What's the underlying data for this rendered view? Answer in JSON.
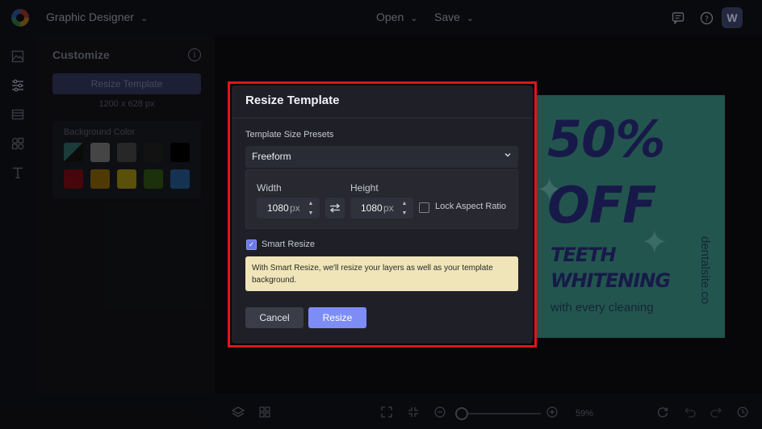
{
  "topbar": {
    "app_mode": "Graphic Designer",
    "open_label": "Open",
    "save_label": "Save",
    "avatar_initial": "W",
    "icons": [
      "comment-icon",
      "help-icon"
    ]
  },
  "rail": {
    "icons": [
      "image-icon",
      "sliders-icon",
      "layout-icon",
      "elements-icon",
      "text-icon"
    ]
  },
  "customize": {
    "title": "Customize",
    "resize_button": "Resize Template",
    "template_size": "1200 x 628 px",
    "background_color_label": "Background Color",
    "swatches": [
      "#2a5a5a",
      "#6a6a6a",
      "#3c3c3c",
      "#1c1c1c",
      "#000000",
      "#6e0a12",
      "#7a5a0a",
      "#8a7a12",
      "#2a4a12",
      "#1f4f80"
    ]
  },
  "design": {
    "headline_1": "50%",
    "headline_2": "OFF",
    "sub_1": "TEETH",
    "sub_2": "WHITENING",
    "tagline": "with every cleaning",
    "site": "dentalsite.co",
    "bg_color": "#37837a"
  },
  "bottombar": {
    "zoom": "59%",
    "zoom_fraction": 0.0
  },
  "modal": {
    "title": "Resize Template",
    "preset_label": "Template Size Presets",
    "preset_value": "Freeform",
    "width_label": "Width",
    "height_label": "Height",
    "width_value": "1080",
    "height_value": "1080",
    "unit": "px",
    "lock_label": "Lock Aspect Ratio",
    "lock_checked": false,
    "smart_label": "Smart Resize",
    "smart_checked": true,
    "smart_note": "With Smart Resize, we'll resize your layers as well as your template background.",
    "cancel_label": "Cancel",
    "resize_label": "Resize",
    "accent": "#7e8df5",
    "highlight_color": "#e0141d"
  }
}
